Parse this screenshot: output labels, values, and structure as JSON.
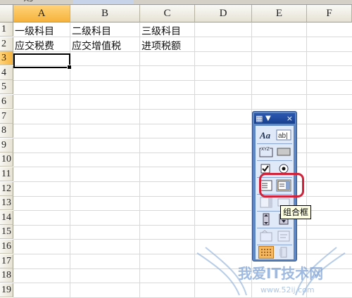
{
  "name_box": {
    "value": "A3"
  },
  "columns": [
    {
      "label": "A",
      "selected": true
    },
    {
      "label": "B",
      "selected": false
    },
    {
      "label": "C",
      "selected": false
    },
    {
      "label": "D",
      "selected": false
    },
    {
      "label": "E",
      "selected": false
    },
    {
      "label": "F",
      "selected": false
    }
  ],
  "rows": [
    "1",
    "2",
    "3",
    "4",
    "5",
    "6",
    "7",
    "8",
    "9",
    "10",
    "11",
    "12",
    "13",
    "14",
    "15",
    "16",
    "17",
    "18",
    "19"
  ],
  "selected_row": "3",
  "cells": {
    "A1": "一级科目",
    "B1": "二级科目",
    "C1": "三级科目",
    "A2": "应交税费",
    "B2": "应交增值税",
    "C2": "进项税额"
  },
  "toolbox": {
    "title_icon": "window-icon",
    "close": "×",
    "tools": [
      {
        "name": "label-tool",
        "icon": "Aa"
      },
      {
        "name": "edit-box-tool",
        "icon": "ab|"
      },
      {
        "name": "group-box-tool",
        "icon": "XYZ"
      },
      {
        "name": "button-tool",
        "icon": "button"
      },
      {
        "name": "checkbox-tool",
        "icon": "check"
      },
      {
        "name": "option-button-tool",
        "icon": "radio"
      },
      {
        "name": "list-box-tool",
        "icon": "list"
      },
      {
        "name": "combo-box-tool",
        "icon": "combo"
      },
      {
        "name": "combo-list-edit-tool",
        "icon": "combo-edit"
      },
      {
        "name": "combo-dropdown-edit-tool",
        "icon": "combo-dropdown"
      },
      {
        "name": "scroll-bar-tool",
        "icon": "scroll"
      },
      {
        "name": "spinner-tool",
        "icon": "spin"
      },
      {
        "name": "control-properties-tool",
        "icon": "properties"
      },
      {
        "name": "edit-code-tool",
        "icon": "code"
      },
      {
        "name": "toggle-grid-tool",
        "icon": "grid"
      },
      {
        "name": "run-dialog-tool",
        "icon": "run"
      }
    ]
  },
  "tooltip": "组合框",
  "watermark": {
    "text": "我爱IT技术网",
    "url": "www.52ij.com"
  },
  "colors": {
    "selected_header": "#f6b33c",
    "toolbox": "#5d86c4",
    "highlight": "#d1223a"
  }
}
